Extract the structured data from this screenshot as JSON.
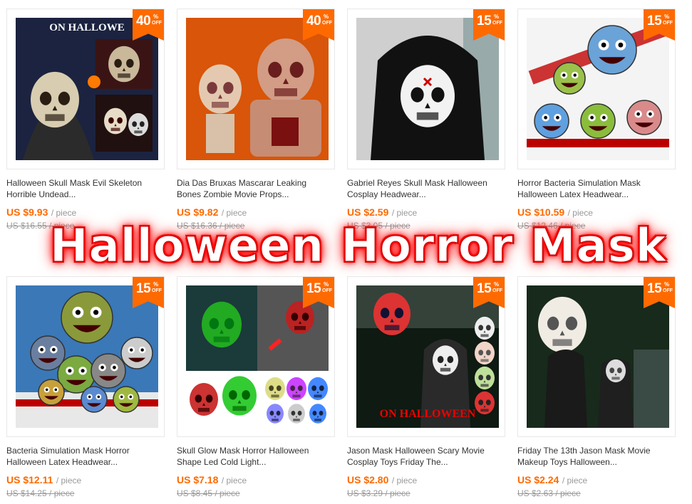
{
  "overlay_title": "Halloween Horror Mask",
  "accent_color": "#ff6a00",
  "products": [
    {
      "discount": "40",
      "pct": "%",
      "off": "OFF",
      "title_line1": "Halloween Skull Mask Evil Skeleton",
      "title_line2": "Horrible Undead...",
      "price": "US $9.93",
      "unit": "/ piece",
      "original_price": "US $16.55 / piece",
      "image_caption": "ON HALLOWE",
      "icon": "skull-mask-image"
    },
    {
      "discount": "40",
      "pct": "%",
      "off": "OFF",
      "title_line1": "Dia Das Bruxas Mascarar Leaking",
      "title_line2": "Bones Zombie Movie Props...",
      "price": "US $9.82",
      "unit": "/ piece",
      "original_price": "US $16.36 / piece",
      "image_caption": "",
      "icon": "zombie-mask-image"
    },
    {
      "discount": "15",
      "pct": "%",
      "off": "OFF",
      "title_line1": "Gabriel Reyes Skull Mask Halloween",
      "title_line2": "Cosplay Headwear...",
      "price": "US $2.59",
      "unit": "/ piece",
      "original_price": "US $3.05 / piece",
      "image_caption": "",
      "icon": "reaper-mask-image"
    },
    {
      "discount": "15",
      "pct": "%",
      "off": "OFF",
      "title_line1": "Horror Bacteria Simulation Mask",
      "title_line2": "Halloween Latex Headwear...",
      "price": "US $10.59",
      "unit": "/ piece",
      "original_price": "US $12.46 / piece",
      "image_caption": "",
      "icon": "bacteria-mask-image"
    },
    {
      "discount": "15",
      "pct": "%",
      "off": "OFF",
      "title_line1": "Bacteria Simulation Mask Horror",
      "title_line2": "Halloween Latex Headwear...",
      "price": "US $12.11",
      "unit": "/ piece",
      "original_price": "US $14.25 / piece",
      "image_caption": "",
      "icon": "bacteria-mask-image"
    },
    {
      "discount": "15",
      "pct": "%",
      "off": "OFF",
      "title_line1": "Skull Glow Mask Horror Halloween",
      "title_line2": "Shape Led Cold Light...",
      "price": "US $7.18",
      "unit": "/ piece",
      "original_price": "US $8.45 / piece",
      "image_caption": "",
      "icon": "glow-skull-mask-image"
    },
    {
      "discount": "15",
      "pct": "%",
      "off": "OFF",
      "title_line1": "Jason Mask Halloween Scary Movie",
      "title_line2": "Cosplay Toys Friday The...",
      "price": "US $2.80",
      "unit": "/ piece",
      "original_price": "US $3.29 / piece",
      "image_caption": "ON HALLOWEEN",
      "icon": "jason-mask-image"
    },
    {
      "discount": "15",
      "pct": "%",
      "off": "OFF",
      "title_line1": "Friday The 13th Jason Mask Movie",
      "title_line2": "Makeup Toys Halloween...",
      "price": "US $2.24",
      "unit": "/ piece",
      "original_price": "US $2.63 / piece",
      "image_caption": "",
      "icon": "jason-mask-image"
    }
  ]
}
